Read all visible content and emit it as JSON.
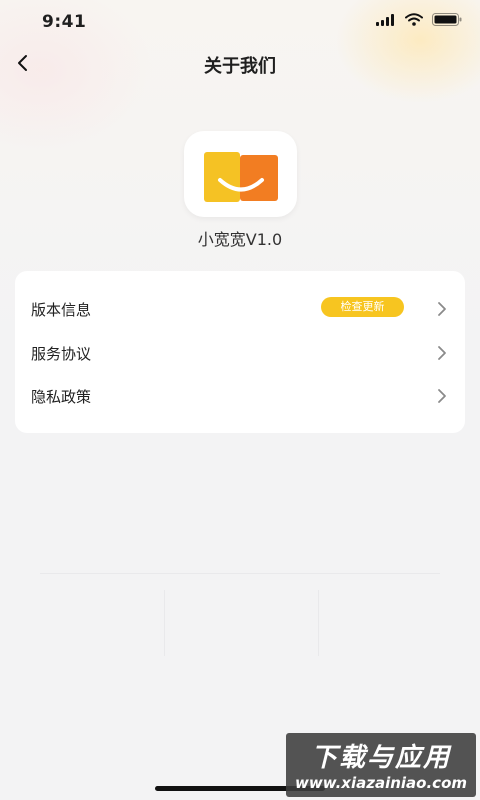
{
  "status_bar": {
    "time": "9:41"
  },
  "header": {
    "title": "关于我们"
  },
  "app": {
    "version_label": "小宽宽V1.0"
  },
  "menu": {
    "items": [
      {
        "label": "版本信息",
        "badge": "检查更新"
      },
      {
        "label": "服务协议"
      },
      {
        "label": "隐私政策"
      }
    ]
  },
  "watermark": {
    "main": "下载与应用",
    "sub": "www.xiazainiao.com"
  },
  "colors": {
    "badge": "#f7c520",
    "logo_yellow": "#f5c224",
    "logo_orange": "#f27d22"
  }
}
